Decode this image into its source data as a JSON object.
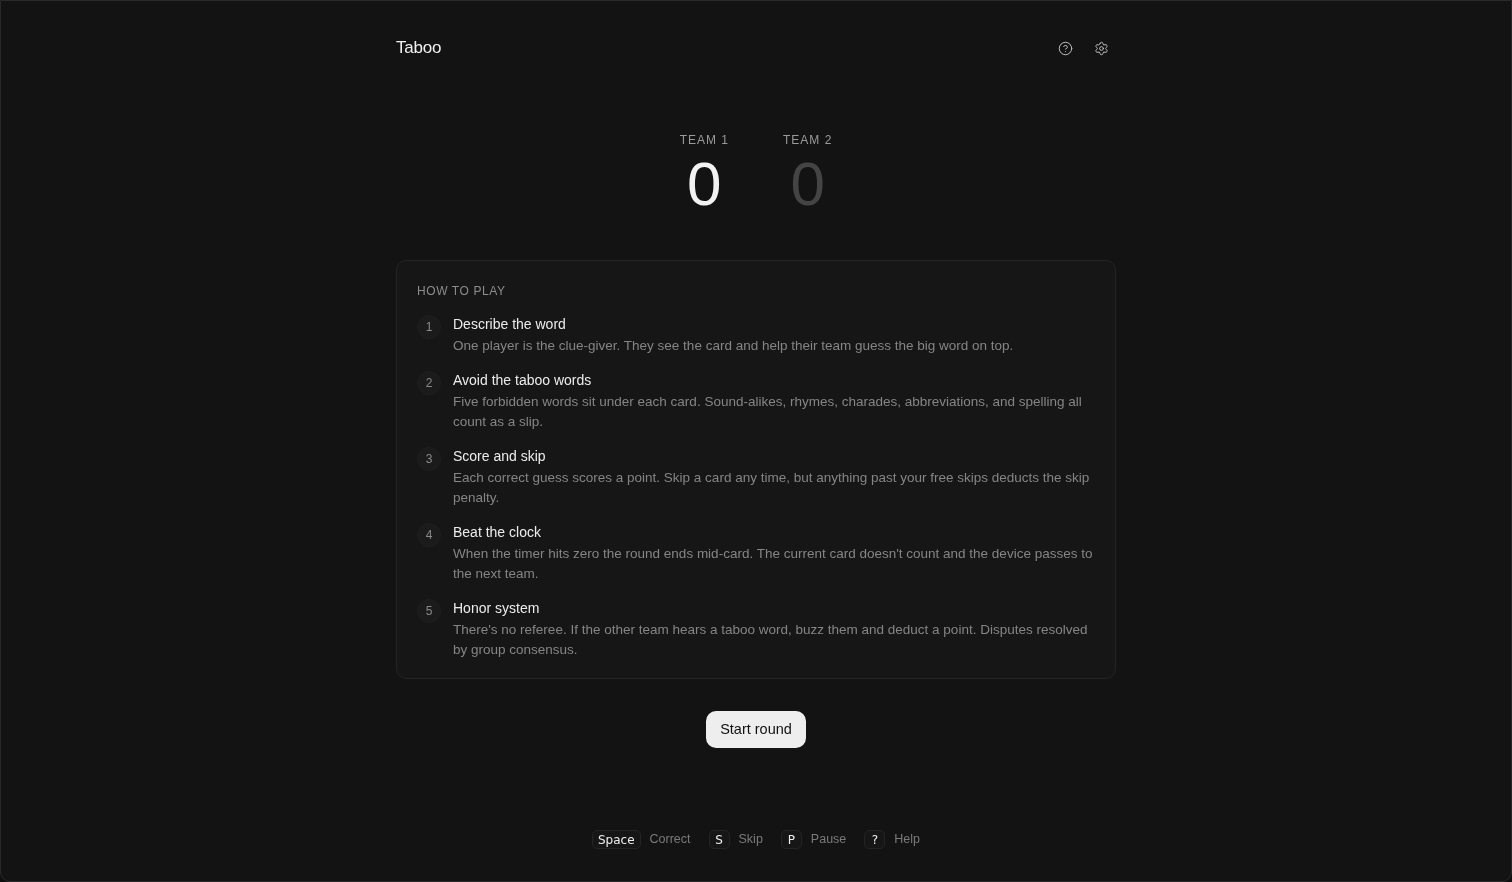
{
  "header": {
    "title": "Taboo"
  },
  "teams": [
    {
      "label": "TEAM 1",
      "score": "0",
      "active": true
    },
    {
      "label": "TEAM 2",
      "score": "0",
      "active": false
    }
  ],
  "how_to_play": {
    "heading": "HOW TO PLAY",
    "steps": [
      {
        "number": "1",
        "title": "Describe the word",
        "description": "One player is the clue-giver. They see the card and help their team guess the big word on top."
      },
      {
        "number": "2",
        "title": "Avoid the taboo words",
        "description": "Five forbidden words sit under each card. Sound-alikes, rhymes, charades, abbreviations, and spelling all count as a slip."
      },
      {
        "number": "3",
        "title": "Score and skip",
        "description": "Each correct guess scores a point. Skip a card any time, but anything past your free skips deducts the skip penalty."
      },
      {
        "number": "4",
        "title": "Beat the clock",
        "description": "When the timer hits zero the round ends mid-card. The current card doesn't count and the device passes to the next team."
      },
      {
        "number": "5",
        "title": "Honor system",
        "description": "There's no referee. If the other team hears a taboo word, buzz them and deduct a point. Disputes resolved by group consensus."
      }
    ]
  },
  "start_button": "Start round",
  "shortcuts": [
    {
      "key": "Space",
      "action": "Correct"
    },
    {
      "key": "S",
      "action": "Skip"
    },
    {
      "key": "P",
      "action": "Pause"
    },
    {
      "key": "?",
      "action": "Help"
    }
  ]
}
